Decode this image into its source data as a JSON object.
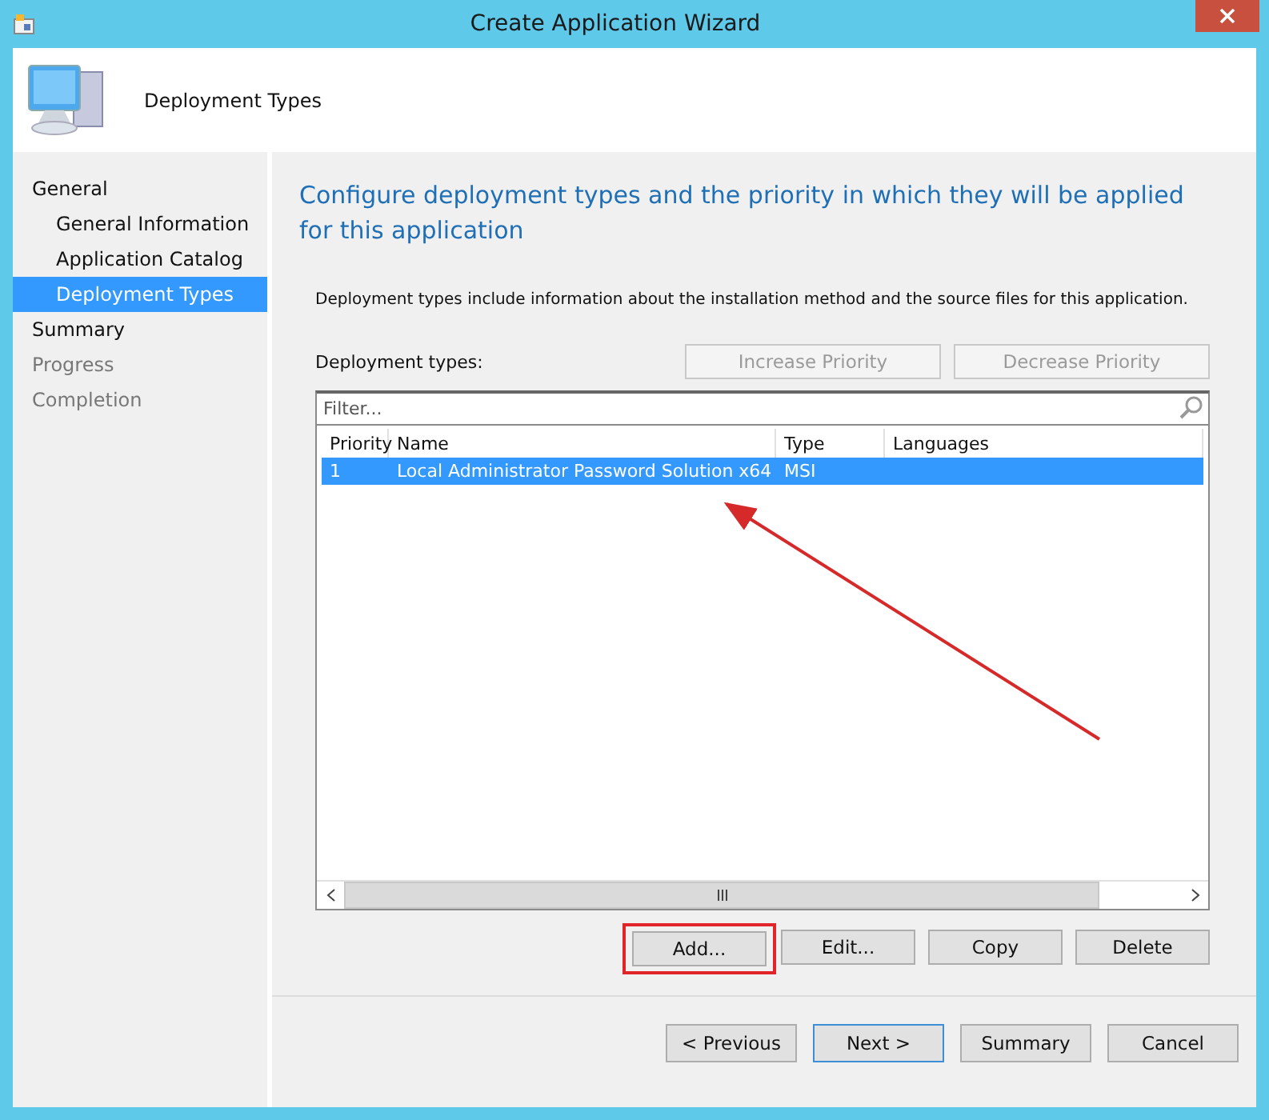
{
  "window": {
    "title": "Create Application Wizard"
  },
  "header": {
    "title": "Deployment Types"
  },
  "sidebar": {
    "items": [
      {
        "label": "General",
        "selected": false,
        "disabled": false,
        "children": [
          {
            "label": "General Information",
            "selected": false,
            "disabled": false
          },
          {
            "label": "Application Catalog",
            "selected": false,
            "disabled": false
          },
          {
            "label": "Deployment Types",
            "selected": true,
            "disabled": false
          }
        ]
      },
      {
        "label": "Summary",
        "selected": false,
        "disabled": false
      },
      {
        "label": "Progress",
        "selected": false,
        "disabled": true
      },
      {
        "label": "Completion",
        "selected": false,
        "disabled": true
      }
    ]
  },
  "content": {
    "heading": "Configure deployment types and the priority in which they will be applied for this application",
    "description": "Deployment types include information about the installation method and the source files for this application.",
    "list_label": "Deployment types:",
    "priority_buttons": [
      {
        "label": "Increase Priority",
        "disabled": true
      },
      {
        "label": "Decrease Priority",
        "disabled": true
      }
    ],
    "filter": {
      "placeholder": "Filter..."
    },
    "table": {
      "columns": [
        "Priority",
        "Name",
        "Type",
        "Languages"
      ],
      "rows": [
        {
          "cells": [
            "1",
            "Local Administrator Password Solution x64",
            "MSI",
            ""
          ],
          "selected": true
        }
      ]
    },
    "actions": [
      {
        "label": "Add...",
        "highlighted": true
      },
      {
        "label": "Edit...",
        "highlighted": false
      },
      {
        "label": "Copy",
        "highlighted": false
      },
      {
        "label": "Delete",
        "highlighted": false
      }
    ]
  },
  "footer": {
    "buttons": [
      {
        "label": "< Previous",
        "default": false
      },
      {
        "label": "Next >",
        "default": true
      },
      {
        "label": "Summary",
        "default": false
      },
      {
        "label": "Cancel",
        "default": false
      }
    ]
  }
}
